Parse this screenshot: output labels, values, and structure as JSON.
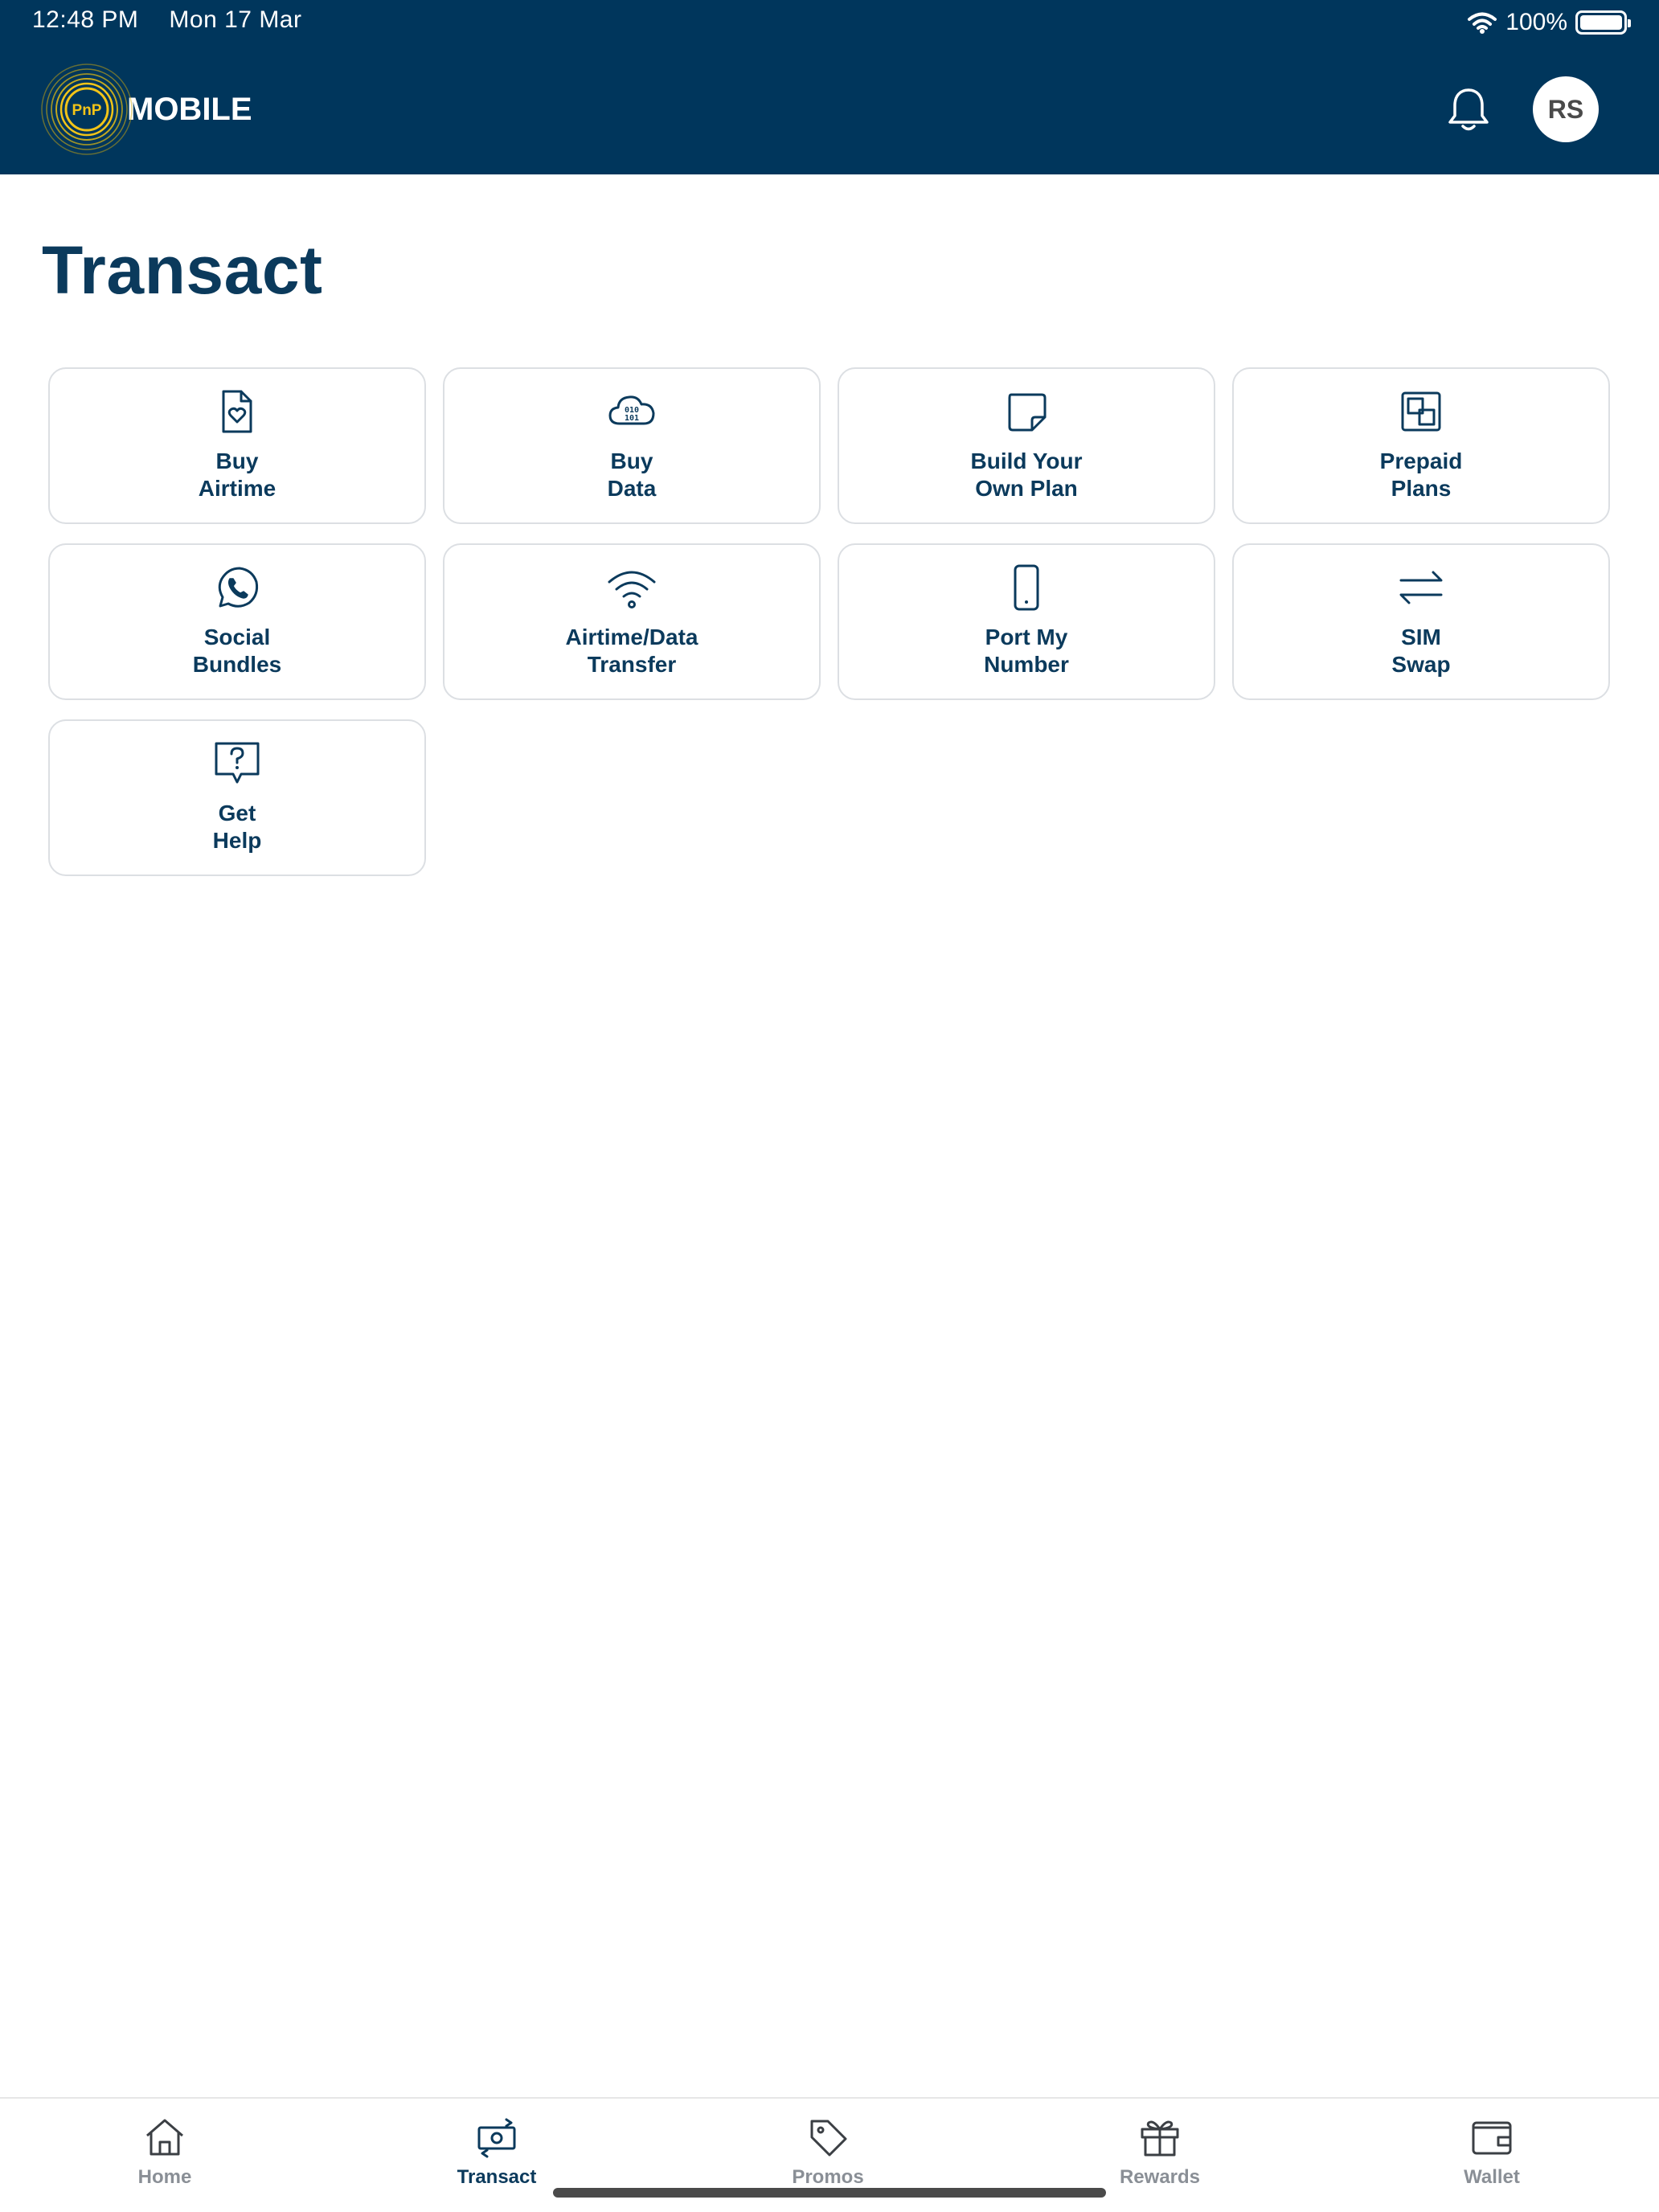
{
  "status_bar": {
    "time": "12:48 PM",
    "date": "Mon 17 Mar",
    "battery": "100%"
  },
  "header": {
    "logo_badge": "PnP",
    "logo_text": "MOBILE",
    "avatar_initials": "RS"
  },
  "page": {
    "title": "Transact"
  },
  "tiles": [
    {
      "line1": "Buy",
      "line2": "Airtime",
      "icon": "airtime-doc-heart-icon"
    },
    {
      "line1": "Buy",
      "line2": "Data",
      "icon": "cloud-binary-icon"
    },
    {
      "line1": "Build Your",
      "line2": "Own Plan",
      "icon": "sticky-note-icon"
    },
    {
      "line1": "Prepaid",
      "line2": "Plans",
      "icon": "squares-icon"
    },
    {
      "line1": "Social",
      "line2": "Bundles",
      "icon": "whatsapp-icon"
    },
    {
      "line1": "Airtime/Data",
      "line2": "Transfer",
      "icon": "wifi-icon"
    },
    {
      "line1": "Port My",
      "line2": "Number",
      "icon": "phone-icon"
    },
    {
      "line1": "SIM",
      "line2": "Swap",
      "icon": "swap-arrows-icon"
    },
    {
      "line1": "Get",
      "line2": "Help",
      "icon": "help-bubble-icon"
    }
  ],
  "bottom_nav": [
    {
      "label": "Home",
      "icon": "home-icon",
      "active": false
    },
    {
      "label": "Transact",
      "icon": "transact-icon",
      "active": true
    },
    {
      "label": "Promos",
      "icon": "tag-icon",
      "active": false
    },
    {
      "label": "Rewards",
      "icon": "gift-icon",
      "active": false
    },
    {
      "label": "Wallet",
      "icon": "wallet-icon",
      "active": false
    }
  ],
  "colors": {
    "header_bg": "#00365c",
    "primary_text": "#0b3a5c",
    "logo_ring": "#f2c418",
    "inactive_nav": "#8a8f96"
  }
}
